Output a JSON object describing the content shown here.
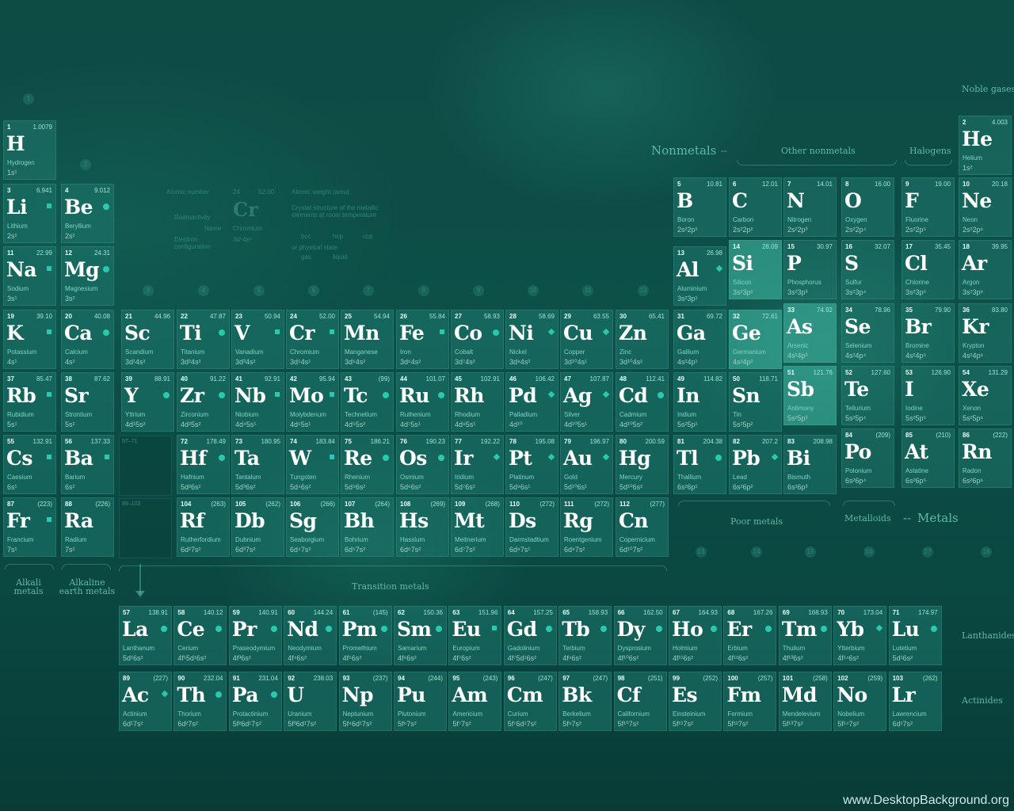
{
  "groups": {
    "g1": {
      "num": "1",
      "label": "Alkali metals"
    },
    "g2": {
      "num": "2",
      "label": "Alkaline earth metals"
    },
    "transition_label": "Transition metals",
    "nonmetals_label": "Nonmetals",
    "other_nonmetals_label": "Other nonmetals",
    "halogens_label": "Halogens",
    "noble_label": "Noble gases",
    "poor_label": "Poor metals",
    "metalloids_label": "Metalloids",
    "metals_label": "Metals",
    "lanthanides_label": "Lanthanides",
    "actinides_label": "Actinides",
    "col_numbers": [
      "3",
      "4",
      "5",
      "6",
      "7",
      "8",
      "9",
      "10",
      "11",
      "12",
      "13",
      "14",
      "15",
      "16",
      "17",
      "18"
    ],
    "placeholder_la": "57–71",
    "placeholder_ac": "89–103"
  },
  "legend": {
    "atomic_number": "Atomic number",
    "atomic_weight": "Atomic weight (amu)",
    "radioactivity": "Radioactivity",
    "name": "Name",
    "electron_config": "Electron configuration",
    "crystal": "Crystal structure of the metallic elements at room temperature",
    "bcc": "bcc",
    "hcp": "hcp",
    "ccp": "ccp",
    "state": "or physical state",
    "gas": "gas",
    "liquid": "liquid",
    "sample_symbol": "Cr",
    "sample_number": "24",
    "sample_mass": "52.00",
    "sample_name": "Chromium",
    "sample_cfg": "3d⁵4s¹"
  },
  "elements": [
    {
      "n": "1",
      "m": "1.0079",
      "s": "H",
      "name": "Hydrogen",
      "c": "1s¹"
    },
    {
      "n": "2",
      "m": "4.003",
      "s": "He",
      "name": "Helium",
      "c": "1s²"
    },
    {
      "n": "3",
      "m": "6.941",
      "s": "Li",
      "name": "Lithium",
      "c": "2s¹"
    },
    {
      "n": "4",
      "m": "9.012",
      "s": "Be",
      "name": "Beryllium",
      "c": "2s²"
    },
    {
      "n": "5",
      "m": "10.81",
      "s": "B",
      "name": "Boron",
      "c": "2s²2p¹"
    },
    {
      "n": "6",
      "m": "12.01",
      "s": "C",
      "name": "Carbon",
      "c": "2s²2p²"
    },
    {
      "n": "7",
      "m": "14.01",
      "s": "N",
      "name": "Nitrogen",
      "c": "2s²2p³"
    },
    {
      "n": "8",
      "m": "16.00",
      "s": "O",
      "name": "Oxygen",
      "c": "2s²2p⁴"
    },
    {
      "n": "9",
      "m": "19.00",
      "s": "F",
      "name": "Fluorine",
      "c": "2s²2p⁵"
    },
    {
      "n": "10",
      "m": "20.18",
      "s": "Ne",
      "name": "Neon",
      "c": "2s²2p⁶"
    },
    {
      "n": "11",
      "m": "22.99",
      "s": "Na",
      "name": "Sodium",
      "c": "3s¹"
    },
    {
      "n": "12",
      "m": "24.31",
      "s": "Mg",
      "name": "Magnesium",
      "c": "3s²"
    },
    {
      "n": "13",
      "m": "26.98",
      "s": "Al",
      "name": "Aluminium",
      "c": "3s²3p¹"
    },
    {
      "n": "14",
      "m": "28.09",
      "s": "Si",
      "name": "Silicon",
      "c": "3s²3p²"
    },
    {
      "n": "15",
      "m": "30.97",
      "s": "P",
      "name": "Phosphorus",
      "c": "3s²3p³"
    },
    {
      "n": "16",
      "m": "32.07",
      "s": "S",
      "name": "Sulfur",
      "c": "3s²3p⁴"
    },
    {
      "n": "17",
      "m": "35.45",
      "s": "Cl",
      "name": "Chlorine",
      "c": "3s²3p⁵"
    },
    {
      "n": "18",
      "m": "39.95",
      "s": "Ar",
      "name": "Argon",
      "c": "3s²3p⁶"
    },
    {
      "n": "19",
      "m": "39.10",
      "s": "K",
      "name": "Potassium",
      "c": "4s¹"
    },
    {
      "n": "20",
      "m": "40.08",
      "s": "Ca",
      "name": "Calcium",
      "c": "4s²"
    },
    {
      "n": "21",
      "m": "44.96",
      "s": "Sc",
      "name": "Scandium",
      "c": "3d¹4s²"
    },
    {
      "n": "22",
      "m": "47.87",
      "s": "Ti",
      "name": "Titanium",
      "c": "3d²4s²"
    },
    {
      "n": "23",
      "m": "50.94",
      "s": "V",
      "name": "Vanadium",
      "c": "3d³4s²"
    },
    {
      "n": "24",
      "m": "52.00",
      "s": "Cr",
      "name": "Chromium",
      "c": "3d⁵4s¹"
    },
    {
      "n": "25",
      "m": "54.94",
      "s": "Mn",
      "name": "Manganese",
      "c": "3d⁵4s²"
    },
    {
      "n": "26",
      "m": "55.84",
      "s": "Fe",
      "name": "Iron",
      "c": "3d⁶4s²"
    },
    {
      "n": "27",
      "m": "58.93",
      "s": "Co",
      "name": "Cobalt",
      "c": "3d⁷4s²"
    },
    {
      "n": "28",
      "m": "58.69",
      "s": "Ni",
      "name": "Nickel",
      "c": "3d⁸4s²"
    },
    {
      "n": "29",
      "m": "63.55",
      "s": "Cu",
      "name": "Copper",
      "c": "3d¹⁰4s¹"
    },
    {
      "n": "30",
      "m": "65.41",
      "s": "Zn",
      "name": "Zinc",
      "c": "3d¹⁰4s²"
    },
    {
      "n": "31",
      "m": "69.72",
      "s": "Ga",
      "name": "Gallium",
      "c": "4s²4p¹"
    },
    {
      "n": "32",
      "m": "72.61",
      "s": "Ge",
      "name": "Germanium",
      "c": "4s²4p²"
    },
    {
      "n": "33",
      "m": "74.92",
      "s": "As",
      "name": "Arsenic",
      "c": "4s²4p³"
    },
    {
      "n": "34",
      "m": "78.96",
      "s": "Se",
      "name": "Selenium",
      "c": "4s²4p⁴"
    },
    {
      "n": "35",
      "m": "79.90",
      "s": "Br",
      "name": "Bromine",
      "c": "4s²4p⁵"
    },
    {
      "n": "36",
      "m": "83.80",
      "s": "Kr",
      "name": "Krypton",
      "c": "4s²4p⁶"
    },
    {
      "n": "37",
      "m": "85.47",
      "s": "Rb",
      "name": "Rubidium",
      "c": "5s¹"
    },
    {
      "n": "38",
      "m": "87.62",
      "s": "Sr",
      "name": "Strontium",
      "c": "5s²"
    },
    {
      "n": "39",
      "m": "88.91",
      "s": "Y",
      "name": "Yttrium",
      "c": "4d¹5s²"
    },
    {
      "n": "40",
      "m": "91.22",
      "s": "Zr",
      "name": "Zirconium",
      "c": "4d²5s²"
    },
    {
      "n": "41",
      "m": "92.91",
      "s": "Nb",
      "name": "Niobium",
      "c": "4d⁴5s¹"
    },
    {
      "n": "42",
      "m": "95.94",
      "s": "Mo",
      "name": "Molybdenum",
      "c": "4d⁵5s¹"
    },
    {
      "n": "43",
      "m": "(99)",
      "s": "Tc",
      "name": "Technetium",
      "c": "4d⁵5s²"
    },
    {
      "n": "44",
      "m": "101.07",
      "s": "Ru",
      "name": "Ruthenium",
      "c": "4d⁷5s¹"
    },
    {
      "n": "45",
      "m": "102.91",
      "s": "Rh",
      "name": "Rhodium",
      "c": "4d⁸5s¹"
    },
    {
      "n": "46",
      "m": "106.42",
      "s": "Pd",
      "name": "Palladium",
      "c": "4d¹⁰"
    },
    {
      "n": "47",
      "m": "107.87",
      "s": "Ag",
      "name": "Silver",
      "c": "4d¹⁰5s¹"
    },
    {
      "n": "48",
      "m": "112.41",
      "s": "Cd",
      "name": "Cadmium",
      "c": "4d¹⁰5s²"
    },
    {
      "n": "49",
      "m": "114.82",
      "s": "In",
      "name": "Indium",
      "c": "5s²5p¹"
    },
    {
      "n": "50",
      "m": "118.71",
      "s": "Sn",
      "name": "Tin",
      "c": "5s²5p²"
    },
    {
      "n": "51",
      "m": "121.76",
      "s": "Sb",
      "name": "Antimony",
      "c": "5s²5p³"
    },
    {
      "n": "52",
      "m": "127.60",
      "s": "Te",
      "name": "Tellurium",
      "c": "5s²5p⁴"
    },
    {
      "n": "53",
      "m": "126.90",
      "s": "I",
      "name": "Iodine",
      "c": "5s²5p⁵"
    },
    {
      "n": "54",
      "m": "131.29",
      "s": "Xe",
      "name": "Xenon",
      "c": "5s²5p⁶"
    },
    {
      "n": "55",
      "m": "132.91",
      "s": "Cs",
      "name": "Caesium",
      "c": "6s¹"
    },
    {
      "n": "56",
      "m": "137.33",
      "s": "Ba",
      "name": "Barium",
      "c": "6s²"
    },
    {
      "n": "72",
      "m": "178.49",
      "s": "Hf",
      "name": "Hafnium",
      "c": "5d²6s²"
    },
    {
      "n": "73",
      "m": "180.95",
      "s": "Ta",
      "name": "Tantalum",
      "c": "5d³6s²"
    },
    {
      "n": "74",
      "m": "183.84",
      "s": "W",
      "name": "Tungsten",
      "c": "5d⁴6s²"
    },
    {
      "n": "75",
      "m": "186.21",
      "s": "Re",
      "name": "Rhenium",
      "c": "5d⁵6s²"
    },
    {
      "n": "76",
      "m": "190.23",
      "s": "Os",
      "name": "Osmium",
      "c": "5d⁶6s²"
    },
    {
      "n": "77",
      "m": "192.22",
      "s": "Ir",
      "name": "Iridium",
      "c": "5d⁷6s²"
    },
    {
      "n": "78",
      "m": "195.08",
      "s": "Pt",
      "name": "Platinum",
      "c": "5d⁹6s¹"
    },
    {
      "n": "79",
      "m": "196.97",
      "s": "Au",
      "name": "Gold",
      "c": "5d¹⁰6s¹"
    },
    {
      "n": "80",
      "m": "200.59",
      "s": "Hg",
      "name": "Mercury",
      "c": "5d¹⁰6s²"
    },
    {
      "n": "81",
      "m": "204.38",
      "s": "Tl",
      "name": "Thallium",
      "c": "6s²6p¹"
    },
    {
      "n": "82",
      "m": "207.2",
      "s": "Pb",
      "name": "Lead",
      "c": "6s²6p²"
    },
    {
      "n": "83",
      "m": "208.98",
      "s": "Bi",
      "name": "Bismuth",
      "c": "6s²6p³"
    },
    {
      "n": "84",
      "m": "(209)",
      "s": "Po",
      "name": "Polonium",
      "c": "6s²6p⁴"
    },
    {
      "n": "85",
      "m": "(210)",
      "s": "At",
      "name": "Astatine",
      "c": "6s²6p⁵"
    },
    {
      "n": "86",
      "m": "(222)",
      "s": "Rn",
      "name": "Radon",
      "c": "6s²6p⁶"
    },
    {
      "n": "87",
      "m": "(223)",
      "s": "Fr",
      "name": "Francium",
      "c": "7s¹"
    },
    {
      "n": "88",
      "m": "(226)",
      "s": "Ra",
      "name": "Radium",
      "c": "7s²"
    },
    {
      "n": "104",
      "m": "(263)",
      "s": "Rf",
      "name": "Rutherfordium",
      "c": "6d²7s²"
    },
    {
      "n": "105",
      "m": "(262)",
      "s": "Db",
      "name": "Dubnium",
      "c": "6d³7s²"
    },
    {
      "n": "106",
      "m": "(266)",
      "s": "Sg",
      "name": "Seaborgium",
      "c": "6d⁴7s²"
    },
    {
      "n": "107",
      "m": "(264)",
      "s": "Bh",
      "name": "Bohrium",
      "c": "6d⁵7s²"
    },
    {
      "n": "108",
      "m": "(269)",
      "s": "Hs",
      "name": "Hassium",
      "c": "6d⁶7s²"
    },
    {
      "n": "109",
      "m": "(268)",
      "s": "Mt",
      "name": "Meitnerium",
      "c": "6d⁷7s²"
    },
    {
      "n": "110",
      "m": "(272)",
      "s": "Ds",
      "name": "Darmstadtium",
      "c": "6d⁹7s¹"
    },
    {
      "n": "111",
      "m": "(272)",
      "s": "Rg",
      "name": "Roentgenium",
      "c": "6d⁹7s²"
    },
    {
      "n": "112",
      "m": "(277)",
      "s": "Cn",
      "name": "Copernicium",
      "c": "6d¹⁰7s²"
    },
    {
      "n": "57",
      "m": "138.91",
      "s": "La",
      "name": "Lanthanum",
      "c": "5d¹6s²"
    },
    {
      "n": "58",
      "m": "140.12",
      "s": "Ce",
      "name": "Cerium",
      "c": "4f¹5d¹6s²"
    },
    {
      "n": "59",
      "m": "140.91",
      "s": "Pr",
      "name": "Praseodymium",
      "c": "4f³6s²"
    },
    {
      "n": "60",
      "m": "144.24",
      "s": "Nd",
      "name": "Neodymium",
      "c": "4f⁴6s²"
    },
    {
      "n": "61",
      "m": "(145)",
      "s": "Pm",
      "name": "Promethium",
      "c": "4f⁵6s²"
    },
    {
      "n": "62",
      "m": "150.36",
      "s": "Sm",
      "name": "Samarium",
      "c": "4f⁶6s²"
    },
    {
      "n": "63",
      "m": "151.96",
      "s": "Eu",
      "name": "Europium",
      "c": "4f⁷6s²"
    },
    {
      "n": "64",
      "m": "157.25",
      "s": "Gd",
      "name": "Gadolinium",
      "c": "4f⁷5d¹6s²"
    },
    {
      "n": "65",
      "m": "158.93",
      "s": "Tb",
      "name": "Terbium",
      "c": "4f⁹6s²"
    },
    {
      "n": "66",
      "m": "162.50",
      "s": "Dy",
      "name": "Dysprosium",
      "c": "4f¹⁰6s²"
    },
    {
      "n": "67",
      "m": "164.93",
      "s": "Ho",
      "name": "Holmium",
      "c": "4f¹¹6s²"
    },
    {
      "n": "68",
      "m": "167.26",
      "s": "Er",
      "name": "Erbium",
      "c": "4f¹²6s²"
    },
    {
      "n": "69",
      "m": "168.93",
      "s": "Tm",
      "name": "Thulium",
      "c": "4f¹³6s²"
    },
    {
      "n": "70",
      "m": "173.04",
      "s": "Yb",
      "name": "Ytterbium",
      "c": "4f¹⁴6s²"
    },
    {
      "n": "71",
      "m": "174.97",
      "s": "Lu",
      "name": "Lutetium",
      "c": "5d¹6s²"
    },
    {
      "n": "89",
      "m": "(227)",
      "s": "Ac",
      "name": "Actinium",
      "c": "6d¹7s²"
    },
    {
      "n": "90",
      "m": "232.04",
      "s": "Th",
      "name": "Thorium",
      "c": "6d²7s²"
    },
    {
      "n": "91",
      "m": "231.04",
      "s": "Pa",
      "name": "Protactinium",
      "c": "5f²6d¹7s²"
    },
    {
      "n": "92",
      "m": "238.03",
      "s": "U",
      "name": "Uranium",
      "c": "5f³6d¹7s²"
    },
    {
      "n": "93",
      "m": "(237)",
      "s": "Np",
      "name": "Neptunium",
      "c": "5f⁴6d¹7s²"
    },
    {
      "n": "94",
      "m": "(244)",
      "s": "Pu",
      "name": "Plutonium",
      "c": "5f⁶7s²"
    },
    {
      "n": "95",
      "m": "(243)",
      "s": "Am",
      "name": "Americium",
      "c": "5f⁷7s²"
    },
    {
      "n": "96",
      "m": "(247)",
      "s": "Cm",
      "name": "Curium",
      "c": "5f⁷6d¹7s²"
    },
    {
      "n": "97",
      "m": "(247)",
      "s": "Bk",
      "name": "Berkelium",
      "c": "5f⁹7s²"
    },
    {
      "n": "98",
      "m": "(251)",
      "s": "Cf",
      "name": "Californium",
      "c": "5f¹⁰7s²"
    },
    {
      "n": "99",
      "m": "(252)",
      "s": "Es",
      "name": "Einsteinium",
      "c": "5f¹¹7s²"
    },
    {
      "n": "100",
      "m": "(257)",
      "s": "Fm",
      "name": "Fermium",
      "c": "5f¹²7s²"
    },
    {
      "n": "101",
      "m": "(258)",
      "s": "Md",
      "name": "Mendelevium",
      "c": "5f¹³7s²"
    },
    {
      "n": "102",
      "m": "(259)",
      "s": "No",
      "name": "Nobelium",
      "c": "5f¹⁴7s²"
    },
    {
      "n": "103",
      "m": "(262)",
      "s": "Lr",
      "name": "Lawrencium",
      "c": "6d¹7s²"
    }
  ],
  "watermark": "www.DesktopBackground.org",
  "colors": {
    "accent": "#29c9b0",
    "background": "#0c5048",
    "cell": "#26827a"
  }
}
